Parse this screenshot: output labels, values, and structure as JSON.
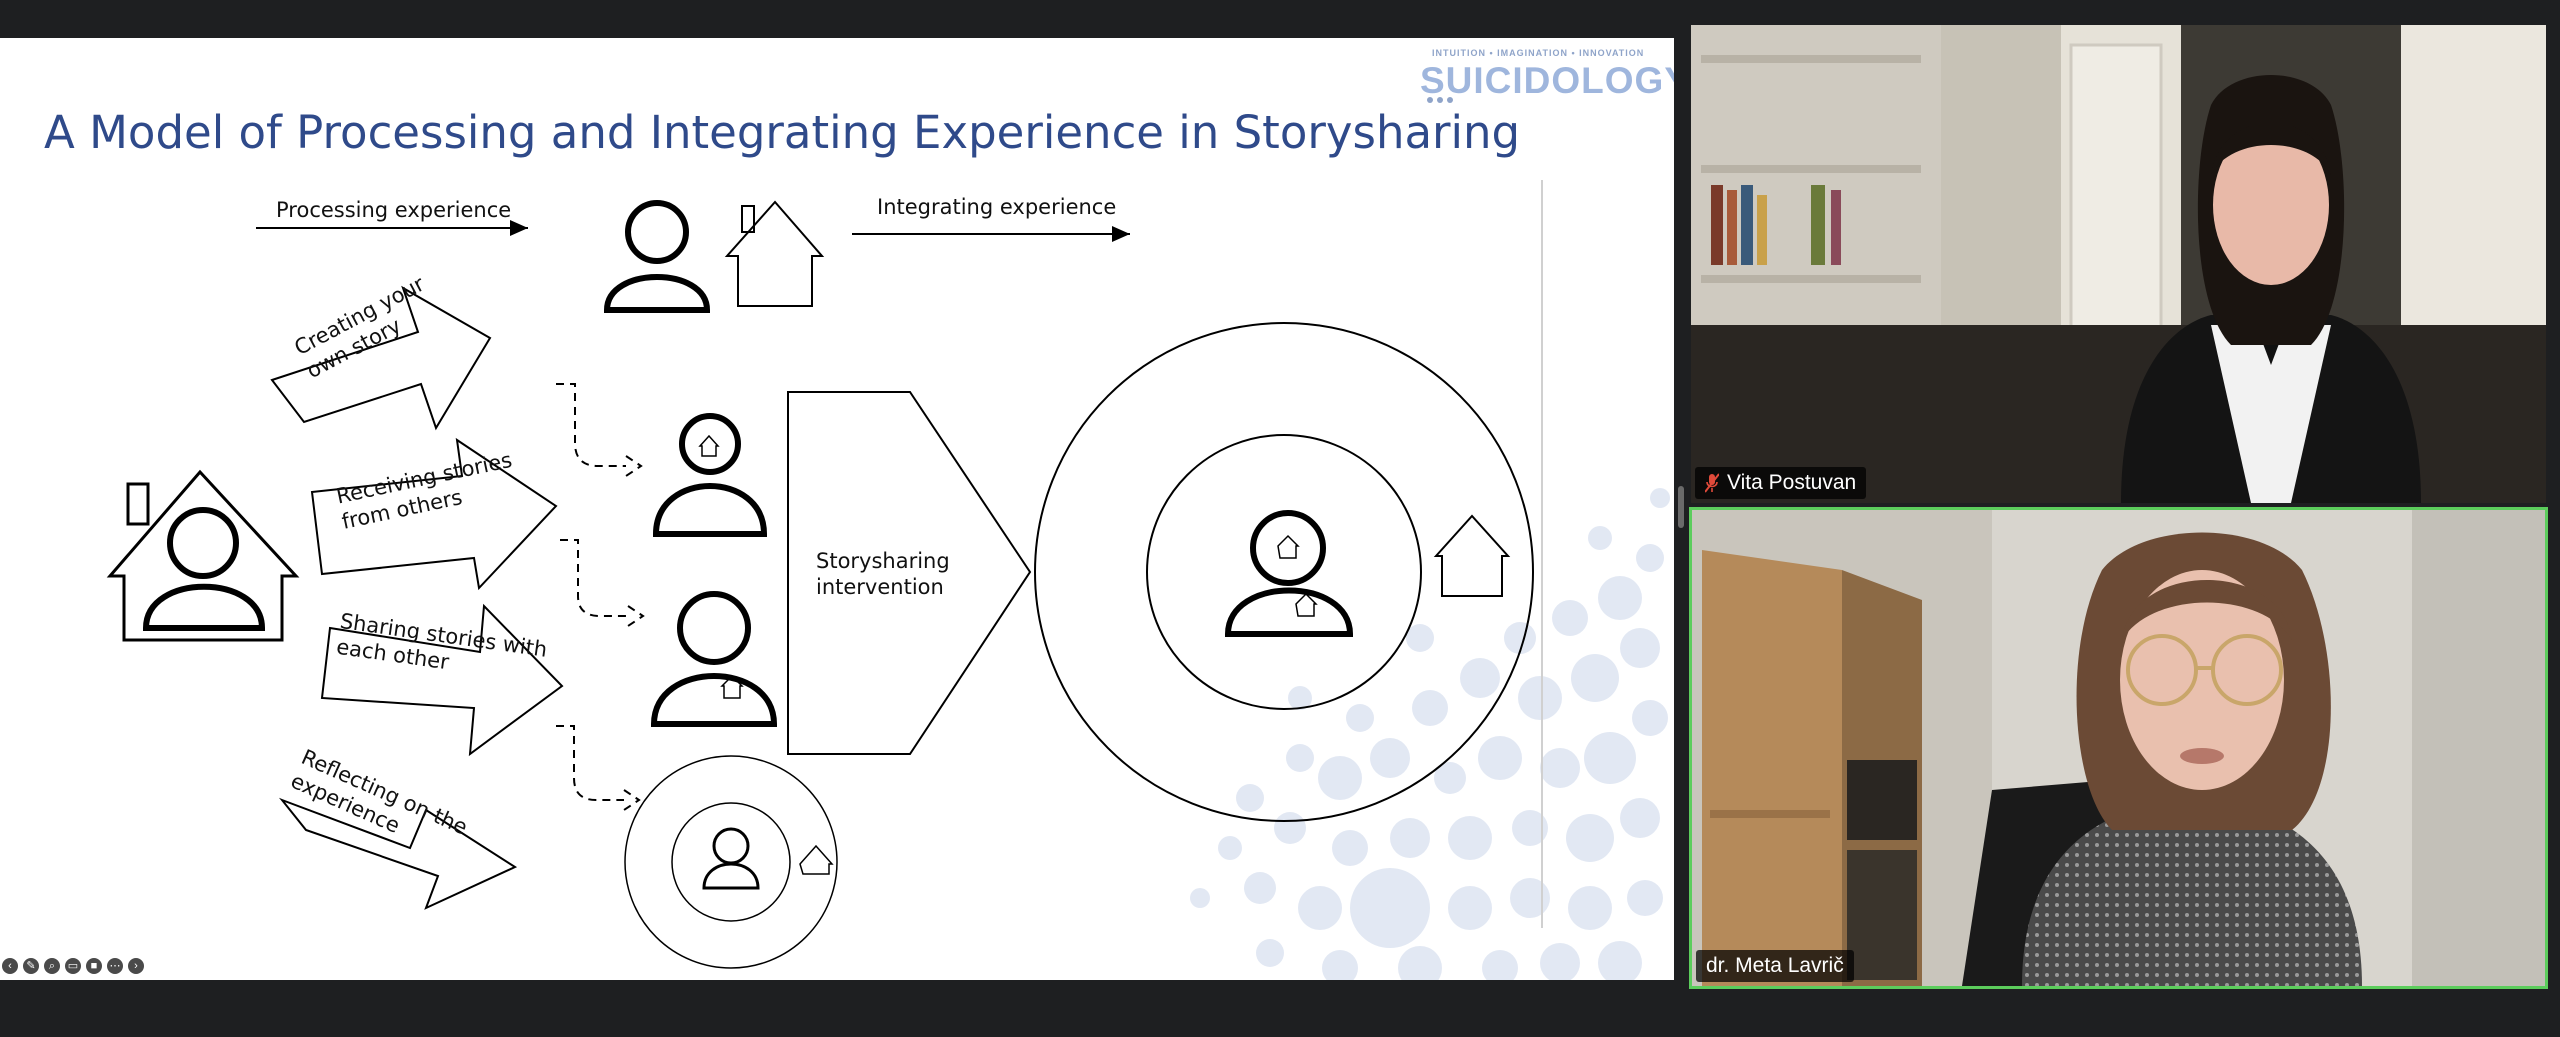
{
  "slide": {
    "title": "A Model of Processing and Integrating Experience in Storysharing",
    "brand_tagline": "INTUITION • IMAGINATION • INNOVATION",
    "brand_name": "SUICIDOLOGY",
    "processing_label": "Processing experience",
    "integrating_label": "Integrating experience",
    "intervention_label": "Storysharing\nintervention",
    "arrows": [
      "Creating your\nown story",
      "Receiving stories\nfrom others",
      "Sharing stories with\neach other",
      "Reflecting on the\nexperience"
    ],
    "accent_color": "#2f4a8a",
    "bubble_color": "#dfe6f2"
  },
  "participants": [
    {
      "name": "Vita Postuvan",
      "muted": true
    },
    {
      "name": "dr. Meta Lavrič",
      "muted": false,
      "active_speaker": true
    }
  ],
  "toolbar_icons": [
    "previous-icon",
    "pen-icon",
    "zoom-icon",
    "subtitles-icon",
    "camera-icon",
    "more-icon",
    "next-icon"
  ],
  "active_speaker_color": "#5ccd5c"
}
